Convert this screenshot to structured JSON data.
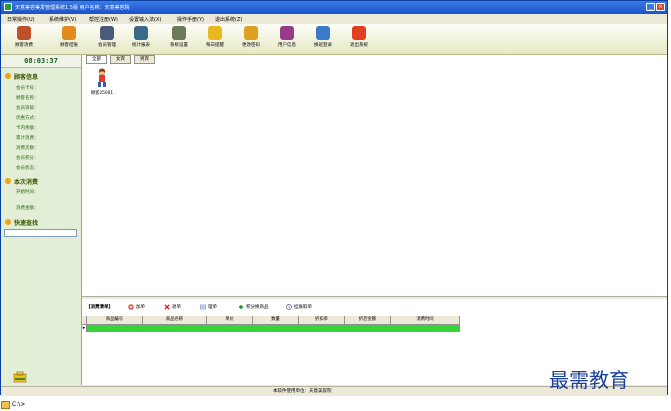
{
  "window": {
    "title": "天意美容美发管理系统1.5版    用户名称：天意美容院"
  },
  "menu": [
    "日常操作(U)",
    "系统维护(V)",
    "帮控注册(W)",
    "设置输入法(X)",
    "操作手册(Y)",
    "退出系统(Z)"
  ],
  "toolbar": [
    {
      "label": "顾客消费",
      "icon": "customer-consume-icon",
      "color": "#c0502a"
    },
    {
      "label": "顾客结账",
      "icon": "checkout-icon",
      "color": "#e08a20"
    },
    {
      "label": "会员管理",
      "icon": "member-icon",
      "color": "#4a5a7a"
    },
    {
      "label": "统计报表",
      "icon": "report-icon",
      "color": "#3a6a8a"
    },
    {
      "label": "系统设置",
      "icon": "settings-icon",
      "color": "#6a7a5a"
    },
    {
      "label": "每日提醒",
      "icon": "reminder-icon",
      "color": "#e8b820"
    },
    {
      "label": "更改密码",
      "icon": "key-icon",
      "color": "#e0a020"
    },
    {
      "label": "用户信息",
      "icon": "user-info-icon",
      "color": "#9a3a8a"
    },
    {
      "label": "换班登录",
      "icon": "shift-login-icon",
      "color": "#3a7ac8"
    },
    {
      "label": "退出系统",
      "icon": "exit-icon",
      "color": "#e04020"
    }
  ],
  "left": {
    "clock": "08:03:37",
    "customer_info": {
      "title": "顾客信息",
      "fields": [
        "会员卡号：",
        "顾客名称：",
        "会员等级：",
        "优惠方式：",
        "卡内余额：",
        "累计消费：",
        "消费次数：",
        "会员积分：",
        "会员状态："
      ]
    },
    "this_consume": {
      "title": "本次消费",
      "fields": [
        "开始时间：",
        "消费金额："
      ]
    },
    "quick_search": {
      "title": "快速查找",
      "value": ""
    }
  },
  "tabs": [
    "全部",
    "女宾",
    "男宾"
  ],
  "rooms": [
    {
      "label": "顾客25001",
      "icon": "customer-figure-icon"
    }
  ],
  "consume_list": {
    "title": "【消费清单】",
    "buttons": [
      {
        "label": "加单",
        "icon": "add-order-icon",
        "color": "#d43a2a"
      },
      {
        "label": "退单",
        "icon": "cancel-order-icon",
        "color": "#d41a1a"
      },
      {
        "label": "理单",
        "icon": "arrange-order-icon",
        "color": "#4a7ab8"
      },
      {
        "label": "积分换商品",
        "icon": "points-exchange-icon",
        "color": "#2a9a3a"
      },
      {
        "label": "挂账取单",
        "icon": "credit-order-icon",
        "color": "#5a5a9a"
      }
    ],
    "columns": [
      "商品编号",
      "商品名称",
      "单价",
      "数量",
      "折扣率",
      "折后金额",
      "消费时间"
    ]
  },
  "status": "本软件使用单位：天意美容院",
  "watermark": "最需教育",
  "taskbar": {
    "label": "C:\\>"
  }
}
